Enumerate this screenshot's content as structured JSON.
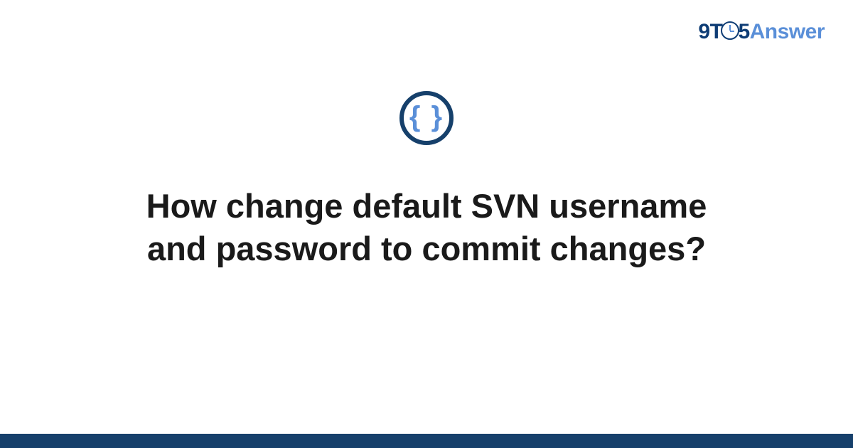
{
  "logo": {
    "part1": "9T",
    "part2": "5",
    "part3": "Answer"
  },
  "icon": {
    "braces": "{ }"
  },
  "question": {
    "title": "How change default SVN username and password to commit changes?"
  },
  "colors": {
    "dark_blue": "#16406b",
    "light_blue": "#5a8fd8",
    "text": "#1a1a1a"
  }
}
